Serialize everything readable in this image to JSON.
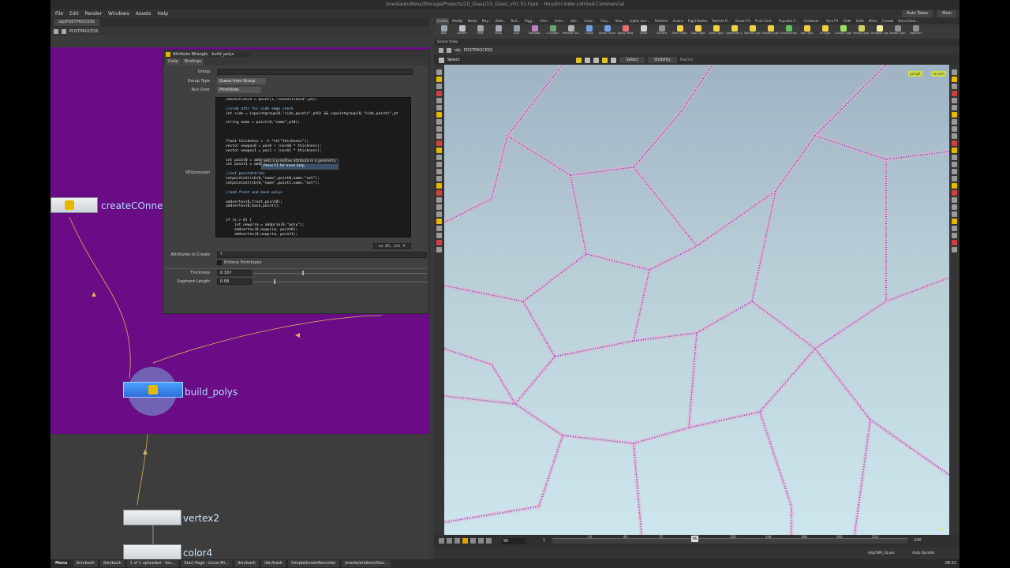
{
  "window": {
    "title": "/media/endless/Storage/Projects/10_Glass/10_Glass_v01.01.hiplc - Houdini Indie Limited-Commercial"
  },
  "menubar": {
    "items": [
      "File",
      "Edit",
      "Render",
      "Windows",
      "Assets",
      "Help"
    ],
    "auto_takes": "Auto Takes",
    "desktop": "Main"
  },
  "left_pane": {
    "path_field": "obj/POSTPROCESS",
    "tab": "POSTPROCESS",
    "params": {
      "node_type": "Attribute Wrangle",
      "node_name": "build_polys",
      "tabs": [
        "Code",
        "Bindings"
      ],
      "group_label": "Group",
      "group_value": "",
      "group_type_label": "Group Type",
      "group_type_value": "Guess from Group",
      "run_over_label": "Run Over",
      "run_over_value": "Primitives",
      "vexpression_label": "VEXpression",
      "code_lines": [
        "connectionid = point(1,\"connectionid\",pt);",
        "",
        "//side attr for side edge check",
        "int side = inpointgroup(0,\"side_points\",pt0) && inpointgroup(0,\"side_points\",pt",
        "",
        "string name = point(0,\"name\",pt0);",
        "",
        "",
        "",
        "float thickness = -1 *ch(\"thickness\");",
        "vector newpos0 = pos0 + (norm0 * thickness);",
        "vector newpos1 = pos1 + (norm1 * thickness);",
        "",
        "int point0 = addpoint(0,pos0);",
        "int point1 = addpoint(0,newpos0);",
        "",
        "//set pointattribs",
        "setpointattrib(0,\"name\",point0,name,\"set\");",
        "setpointattrib(0,\"name\",point1,name,\"set\");",
        "",
        "//add front and back polys",
        "",
        "addvertex(0,front,point0);",
        "addvertex(0,back,point1);",
        "",
        "",
        "if (e > 0) {",
        "    int newprim = addprim(0,\"poly\");",
        "    addvertex(0,newprim, point0);",
        "    addvertex(0,newprim, point1);"
      ],
      "tooltip_line1": "Sets a primitive attribute in a geometry.",
      "tooltip_line2": "Press F1 for more help.",
      "line_col": "Ln 85, Col 9",
      "attributes_label": "Attributes to Create",
      "attributes_value": "*",
      "enforce_label": "Enforce Prototypes",
      "thickness_label": "Thickness",
      "thickness_value": "0.167",
      "thickness_fraction": 0.28,
      "segment_label": "Segment Length",
      "segment_value": "0.08",
      "segment_fraction": 0.12
    },
    "nodes": {
      "create": "createCOnnec",
      "build": "build_polys",
      "vertex": "vertex2",
      "color": "color4"
    }
  },
  "shelf": {
    "tabs": [
      "Create",
      "Modify",
      "Model",
      "Poly...",
      "Defo...",
      "Text...",
      "Rigg...",
      "Char...",
      "Anim...",
      "Hair...",
      "Grooi...",
      "Clou...",
      "Volu...",
      "Lights and ...",
      "Particles",
      "Grains",
      "Rigid Bodies",
      "Particle Fl...",
      "Ocean FX",
      "Fluid Cont...",
      "Populate C...",
      "Container...",
      "Pyro FX",
      "Cloth",
      "Solid",
      "Wires",
      "Crowds",
      "Drive Simu..."
    ],
    "tools": [
      {
        "label": "Box",
        "color": "#9aa4ad"
      },
      {
        "label": "Sphere",
        "color": "#b8c0c8"
      },
      {
        "label": "Tube",
        "color": "#a3a3a3"
      },
      {
        "label": "Torus",
        "color": "#a8a8b4"
      },
      {
        "label": "Grid",
        "color": "#8ea0b0"
      },
      {
        "label": "Metaball",
        "color": "#c080c0"
      },
      {
        "label": "L-System",
        "color": "#6ca06c"
      },
      {
        "label": "Platonic Sol...",
        "color": "#b0b0b0"
      },
      {
        "label": "Curve",
        "color": "#70a0e0"
      },
      {
        "label": "Draw Curve",
        "color": "#70a0e0"
      },
      {
        "label": "Spray Paint",
        "color": "#e07070"
      },
      {
        "label": "Circle",
        "color": "#d0d0d0"
      },
      {
        "label": "Camera",
        "color": "#909090"
      },
      {
        "label": "Point Light",
        "color": "#f0d040"
      },
      {
        "label": "Spot Light",
        "color": "#f0d040"
      },
      {
        "label": "Area Light",
        "color": "#f0d040"
      },
      {
        "label": "Geometry L...",
        "color": "#f0d040"
      },
      {
        "label": "Volume Light",
        "color": "#f0d040"
      },
      {
        "label": "Distant Light",
        "color": "#f0d040"
      },
      {
        "label": "Environmen...",
        "color": "#60c060"
      },
      {
        "label": "Sky Light",
        "color": "#f0d040"
      },
      {
        "label": "GI Light",
        "color": "#f0d040"
      },
      {
        "label": "Caustic Light",
        "color": "#a0e060"
      },
      {
        "label": "Portal Light",
        "color": "#d0d060"
      },
      {
        "label": "Ambient Lig...",
        "color": "#f0f0a0"
      },
      {
        "label": "Stereo Cam...",
        "color": "#909090"
      },
      {
        "label": "Switcher",
        "color": "#909090"
      }
    ]
  },
  "viewer": {
    "tab": "Scene View",
    "path_field": "obj",
    "path_crumb": "POSTPROCESS",
    "tool": "Select",
    "select_mode": "Select",
    "visibility": "Visibility",
    "radius": "Radius",
    "badge_left": "persp1",
    "badge_right": "no cam",
    "corner_label": "obj"
  },
  "timeline": {
    "frame": "96",
    "start": "1",
    "end": "240",
    "ticks": [
      "24",
      "48",
      "72",
      "96",
      "120",
      "144",
      "168",
      "192",
      "216"
    ],
    "current_fraction": 0.4
  },
  "status": {
    "path": "/obj/SIM_GLass",
    "auto_update": "Auto Update"
  },
  "taskbar": {
    "menu": "Menu",
    "items": [
      "/bin/bash",
      "/bin/bash",
      "1 of 1 uploaded - You...",
      "Start Page - Linux Mi...",
      "/bin/bash",
      "/bin/bash",
      "SimpleScreenRecorder",
      "/media/endless/Stor..."
    ],
    "clock": "08:21"
  }
}
